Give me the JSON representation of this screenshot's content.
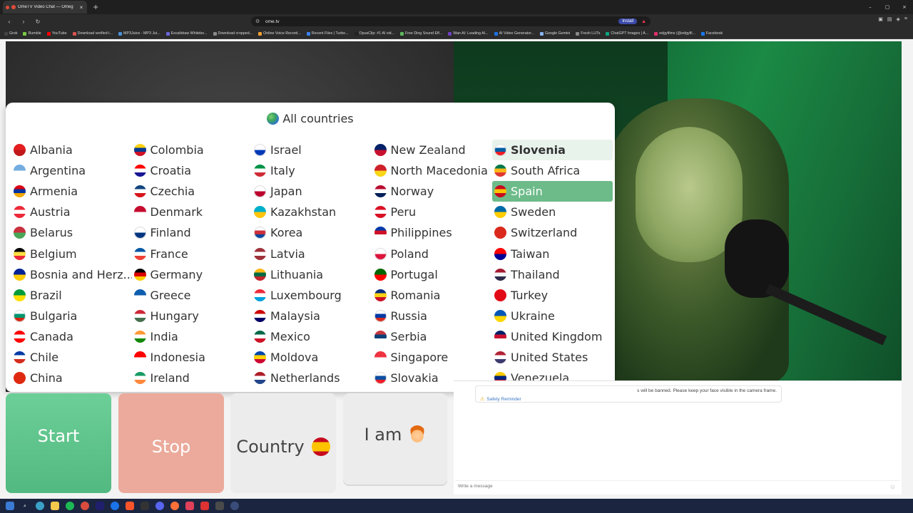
{
  "browser": {
    "tab_title": "OmeTV Video Chat — Omeg",
    "new_tab_glyph": "+",
    "tab_close_glyph": "×",
    "url": "ome.tv",
    "install_label": "Install",
    "window_controls": [
      "–",
      "▢",
      "×"
    ],
    "bookmarks": [
      {
        "label": "Grok",
        "color": "#444444"
      },
      {
        "label": "Rumble",
        "color": "#7ac943"
      },
      {
        "label": "YouTube",
        "color": "#ff0000"
      },
      {
        "label": "Download verified t...",
        "color": "#d9534f"
      },
      {
        "label": "MP3Juice - MP3 Jui...",
        "color": "#4a90d9"
      },
      {
        "label": "Excalidraw Whitebo...",
        "color": "#6965db"
      },
      {
        "label": "Download cropped...",
        "color": "#8a8a8a"
      },
      {
        "label": "Online Voice Record...",
        "color": "#f0a030"
      },
      {
        "label": "Recent Files | Turbo...",
        "color": "#3b82f6"
      },
      {
        "label": "OpusClip: #1 AI vid...",
        "color": "#222222"
      },
      {
        "label": "Free Ding Sound Eff...",
        "color": "#5cb85c"
      },
      {
        "label": "Wan AI: Leading AI...",
        "color": "#6f42c1"
      },
      {
        "label": "AI Video Generator...",
        "color": "#1a73e8"
      },
      {
        "label": "Google Gemini",
        "color": "#8ab4f8"
      },
      {
        "label": "Fresh LUTs",
        "color": "#888888"
      },
      {
        "label": "ChatGPT Images | A...",
        "color": "#10a37f"
      },
      {
        "label": "edgyfilms (@edgyfil...",
        "color": "#e1306c"
      },
      {
        "label": "Facebook",
        "color": "#1877f2"
      }
    ]
  },
  "dropdown": {
    "title": "All countries",
    "hover_country": "Slovenia",
    "selected_country": "Spain",
    "countries": [
      {
        "name": "Albania",
        "flag": [
          "#e41e20",
          "#c0171a"
        ]
      },
      {
        "name": "Argentina",
        "flag": [
          "#74acdf",
          "#ffffff"
        ]
      },
      {
        "name": "Armenia",
        "flag": [
          "#d90012",
          "#0033a0",
          "#f2a800"
        ]
      },
      {
        "name": "Austria",
        "flag": [
          "#ed2939",
          "#ffffff",
          "#ed2939"
        ]
      },
      {
        "name": "Belarus",
        "flag": [
          "#c8313e",
          "#4aa657"
        ]
      },
      {
        "name": "Belgium",
        "flag": [
          "#000000",
          "#fae042",
          "#ed2939"
        ]
      },
      {
        "name": "Bosnia and Herz...",
        "flag": [
          "#002395",
          "#fecb00"
        ]
      },
      {
        "name": "Brazil",
        "flag": [
          "#009c3b",
          "#ffdf00"
        ]
      },
      {
        "name": "Bulgaria",
        "flag": [
          "#ffffff",
          "#00966e",
          "#d62612"
        ]
      },
      {
        "name": "Canada",
        "flag": [
          "#ff0000",
          "#ffffff",
          "#ff0000"
        ]
      },
      {
        "name": "Chile",
        "flag": [
          "#0039a6",
          "#ffffff",
          "#d52b1e"
        ]
      },
      {
        "name": "China",
        "flag": [
          "#de2910",
          "#de2910"
        ]
      },
      {
        "name": "Colombia",
        "flag": [
          "#fcd116",
          "#003893",
          "#ce1126"
        ]
      },
      {
        "name": "Croatia",
        "flag": [
          "#ff0000",
          "#ffffff",
          "#171796"
        ]
      },
      {
        "name": "Czechia",
        "flag": [
          "#11457e",
          "#ffffff",
          "#d7141a"
        ]
      },
      {
        "name": "Denmark",
        "flag": [
          "#c60c30",
          "#ffffff"
        ]
      },
      {
        "name": "Finland",
        "flag": [
          "#ffffff",
          "#003580"
        ]
      },
      {
        "name": "France",
        "flag": [
          "#0055a4",
          "#ffffff",
          "#ef4135"
        ]
      },
      {
        "name": "Germany",
        "flag": [
          "#000000",
          "#dd0000",
          "#ffce00"
        ]
      },
      {
        "name": "Greece",
        "flag": [
          "#0d5eaf",
          "#ffffff"
        ]
      },
      {
        "name": "Hungary",
        "flag": [
          "#ce2939",
          "#ffffff",
          "#477050"
        ]
      },
      {
        "name": "India",
        "flag": [
          "#ff9933",
          "#ffffff",
          "#138808"
        ]
      },
      {
        "name": "Indonesia",
        "flag": [
          "#ff0000",
          "#ffffff"
        ]
      },
      {
        "name": "Ireland",
        "flag": [
          "#169b62",
          "#ffffff",
          "#ff883e"
        ]
      },
      {
        "name": "Israel",
        "flag": [
          "#ffffff",
          "#0038b8"
        ]
      },
      {
        "name": "Italy",
        "flag": [
          "#009246",
          "#ffffff",
          "#ce2b37"
        ]
      },
      {
        "name": "Japan",
        "flag": [
          "#ffffff",
          "#bc002d"
        ]
      },
      {
        "name": "Kazakhstan",
        "flag": [
          "#00afca",
          "#fec50c"
        ]
      },
      {
        "name": "Korea",
        "flag": [
          "#ffffff",
          "#cd2e3a",
          "#0047a0"
        ]
      },
      {
        "name": "Latvia",
        "flag": [
          "#9e3039",
          "#ffffff",
          "#9e3039"
        ]
      },
      {
        "name": "Lithuania",
        "flag": [
          "#fdb913",
          "#006a44",
          "#c1272d"
        ]
      },
      {
        "name": "Luxembourg",
        "flag": [
          "#ed2939",
          "#ffffff",
          "#00a1de"
        ]
      },
      {
        "name": "Malaysia",
        "flag": [
          "#cc0001",
          "#ffffff",
          "#010066"
        ]
      },
      {
        "name": "Mexico",
        "flag": [
          "#006847",
          "#ffffff",
          "#ce1126"
        ]
      },
      {
        "name": "Moldova",
        "flag": [
          "#0046ae",
          "#ffd200",
          "#cc092f"
        ]
      },
      {
        "name": "Netherlands",
        "flag": [
          "#ae1c28",
          "#ffffff",
          "#21468b"
        ]
      },
      {
        "name": "New Zealand",
        "flag": [
          "#012169",
          "#c8102e"
        ]
      },
      {
        "name": "North Macedonia",
        "flag": [
          "#ce2028",
          "#f9d616"
        ]
      },
      {
        "name": "Norway",
        "flag": [
          "#ba0c2f",
          "#ffffff",
          "#00205b"
        ]
      },
      {
        "name": "Peru",
        "flag": [
          "#d91023",
          "#ffffff",
          "#d91023"
        ]
      },
      {
        "name": "Philippines",
        "flag": [
          "#0038a8",
          "#ce1126",
          "#ffffff"
        ]
      },
      {
        "name": "Poland",
        "flag": [
          "#ffffff",
          "#dc143c"
        ]
      },
      {
        "name": "Portugal",
        "flag": [
          "#006600",
          "#ff0000"
        ]
      },
      {
        "name": "Romania",
        "flag": [
          "#002b7f",
          "#fcd116",
          "#ce1126"
        ]
      },
      {
        "name": "Russia",
        "flag": [
          "#ffffff",
          "#0039a6",
          "#d52b1e"
        ]
      },
      {
        "name": "Serbia",
        "flag": [
          "#c6363c",
          "#0c4076",
          "#ffffff"
        ]
      },
      {
        "name": "Singapore",
        "flag": [
          "#ef3340",
          "#ffffff"
        ]
      },
      {
        "name": "Slovakia",
        "flag": [
          "#ffffff",
          "#0b4ea2",
          "#ee1c25"
        ]
      },
      {
        "name": "Slovenia",
        "flag": [
          "#ffffff",
          "#005da4",
          "#ed1c24"
        ]
      },
      {
        "name": "South Africa",
        "flag": [
          "#007749",
          "#ffb81c",
          "#de3831"
        ]
      },
      {
        "name": "Spain",
        "flag": [
          "#c60b1e",
          "#ffc400",
          "#c60b1e"
        ]
      },
      {
        "name": "Sweden",
        "flag": [
          "#006aa7",
          "#fecc00"
        ]
      },
      {
        "name": "Switzerland",
        "flag": [
          "#da291c",
          "#da291c"
        ]
      },
      {
        "name": "Taiwan",
        "flag": [
          "#fe0000",
          "#000095"
        ]
      },
      {
        "name": "Thailand",
        "flag": [
          "#a51931",
          "#f4f5f8",
          "#2d2a4a"
        ]
      },
      {
        "name": "Turkey",
        "flag": [
          "#e30a17",
          "#e30a17"
        ]
      },
      {
        "name": "Ukraine",
        "flag": [
          "#0057b7",
          "#ffd700"
        ]
      },
      {
        "name": "United Kingdom",
        "flag": [
          "#012169",
          "#c8102e",
          "#ffffff"
        ]
      },
      {
        "name": "United States",
        "flag": [
          "#b22234",
          "#ffffff",
          "#3c3b6e"
        ]
      },
      {
        "name": "Venezuela",
        "flag": [
          "#ffcc00",
          "#00247d",
          "#cf142b"
        ]
      }
    ]
  },
  "chat": {
    "notice_text": "s will be banned. Please keep your face visible in the camera frame.",
    "safety_link": "Safety Reminder",
    "message_placeholder": "Write a message"
  },
  "controls": {
    "start_label": "Start",
    "stop_label": "Stop",
    "country_label": "Country",
    "iam_label": "I am"
  },
  "colors": {
    "start": "#5cc48b",
    "stop": "#ebaa9b",
    "selected_row": "#6dbb89"
  }
}
